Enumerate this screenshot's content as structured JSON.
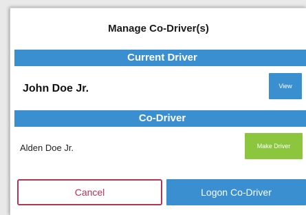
{
  "dialog": {
    "title": "Manage Co-Driver(s)"
  },
  "current_driver": {
    "header": "Current Driver",
    "name": "John Doe Jr.",
    "view_label": "View"
  },
  "co_driver": {
    "header": "Co-Driver",
    "name": "Alden Doe Jr.",
    "make_driver_label": "Make Driver"
  },
  "actions": {
    "cancel_label": "Cancel",
    "logon_label": "Logon Co-Driver"
  },
  "colors": {
    "primary_blue": "#3a8fd1",
    "make_driver_green": "#8cc63f",
    "cancel_red": "#b8334f"
  }
}
